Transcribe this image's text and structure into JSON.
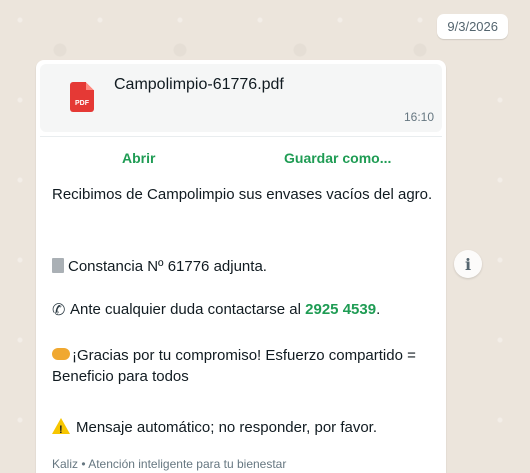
{
  "date_pill": "9/3/2026",
  "file": {
    "icon_label": "PDF",
    "name": "Campolimpio-61776.pdf",
    "time": "16:10"
  },
  "actions": {
    "open": "Abrir",
    "save": "Guardar como..."
  },
  "message": {
    "line1": "Recibimos de Campolimpio sus envases vacíos del agro.",
    "line2": "Constancia Nº 61776 adjunta.",
    "line3_prefix": "Ante cualquier duda contactarse al ",
    "phone": "2925 4539",
    "line3_suffix": ".",
    "line4": "¡Gracias por tu compromiso! Esfuerzo compartido = Beneficio para todos",
    "line5": "Mensaje automático; no responder, por favor.",
    "footer": "Kaliz • Atención inteligente para tu bienestar"
  },
  "info_button": "i",
  "icons": [
    "pdf-icon",
    "document-icon",
    "phone-icon",
    "handshake-icon",
    "warning-icon",
    "info-icon"
  ],
  "colors": {
    "accent_green": "#1f9c54",
    "pdf_red": "#e53935",
    "background": "#ece5dc"
  }
}
